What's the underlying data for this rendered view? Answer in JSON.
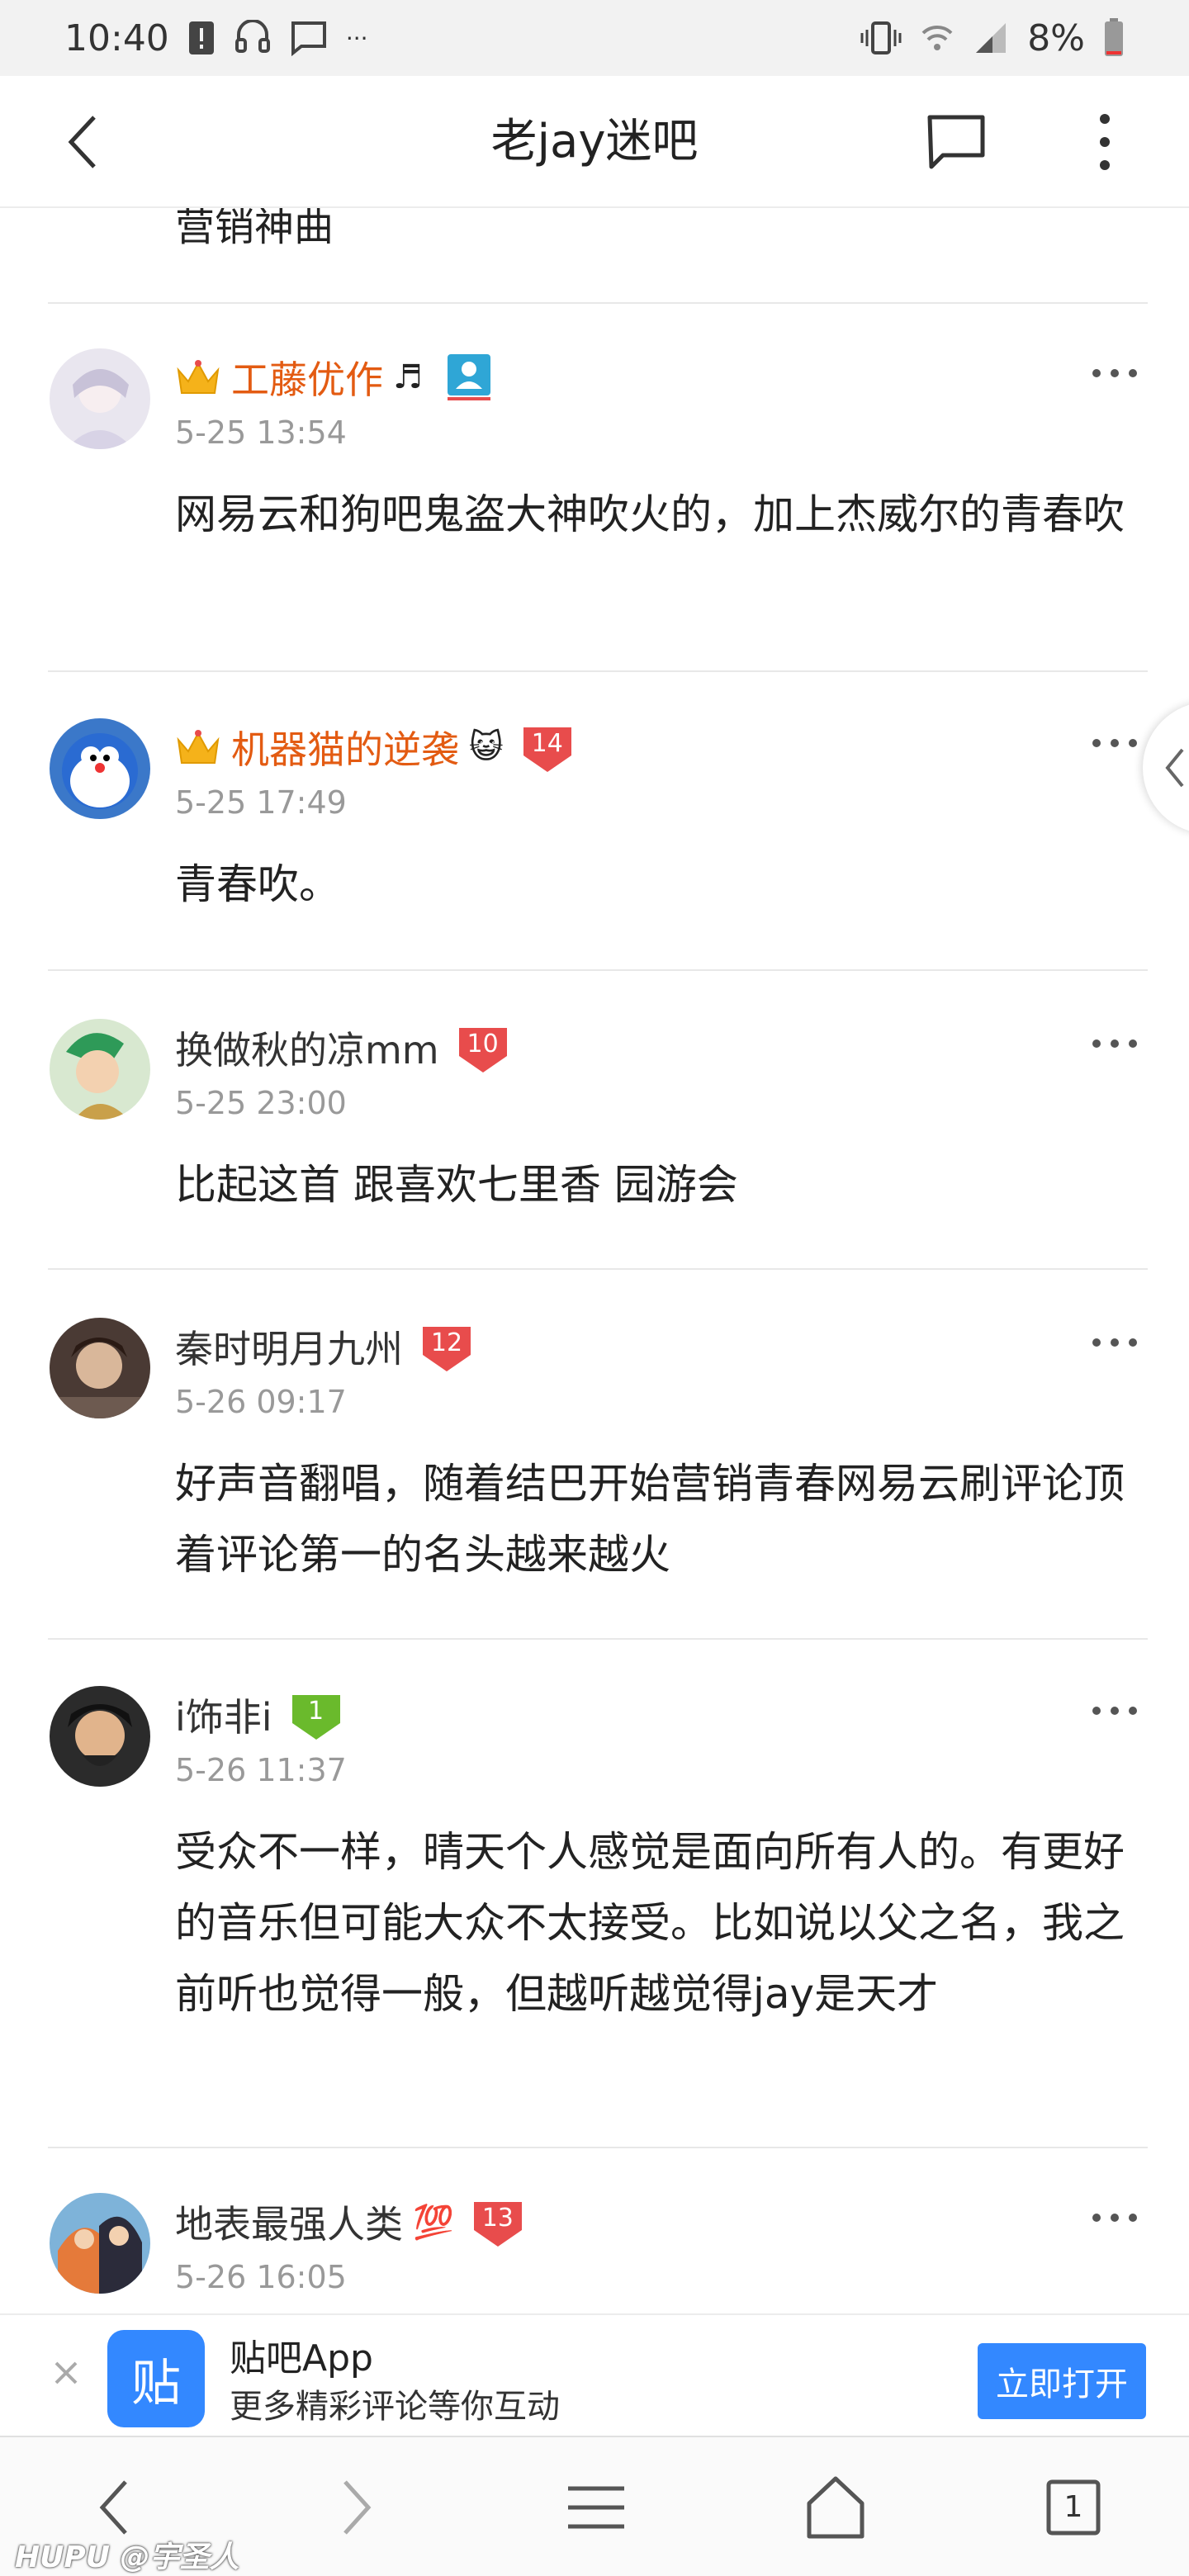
{
  "status_bar": {
    "time": "10:40",
    "notif_more": "···",
    "battery": "8%",
    "icons": [
      "alert-icon",
      "headset-icon",
      "message-icon",
      "vibrate-icon",
      "wifi-icon",
      "signal-icon",
      "battery-icon"
    ]
  },
  "nav": {
    "title": "老jay迷吧",
    "back_icon": "back-arrow-icon",
    "chat_icon": "comment-icon",
    "more_icon": "more-vertical-icon"
  },
  "feed": {
    "cut_text": "营销神曲",
    "posts": [
      {
        "username": "工藤优作",
        "suffix": "♬",
        "vip": true,
        "badge_type": "user-card",
        "time": "5-25 13:54",
        "body": "网易云和狗吧鬼盗大神吹火的，加上杰威尔的青春吹"
      },
      {
        "username": "机器猫的逆袭",
        "suffix": "😺",
        "vip": true,
        "badge_type": "level",
        "level": "14",
        "time": "5-25 17:49",
        "body": "青春吹。"
      },
      {
        "username": "换做秋的凉mm",
        "suffix": "",
        "vip": false,
        "badge_type": "level",
        "level": "10",
        "time": "5-25 23:00",
        "body": "比起这首 跟喜欢七里香 园游会"
      },
      {
        "username": "秦时明月九州",
        "suffix": "",
        "vip": false,
        "badge_type": "level",
        "level": "12",
        "time": "5-26 09:17",
        "body": "好声音翻唱，随着结巴开始营销青春网易云刷评论顶着评论第一的名头越来越火"
      },
      {
        "username": "i饰非i",
        "suffix": "",
        "vip": false,
        "badge_type": "level-green",
        "level": "1",
        "time": "5-26 11:37",
        "body": "受众不一样，晴天个人感觉是面向所有人的。有更好的音乐但可能大众不太接受。比如说以父之名，我之前听也觉得一般，但越听越觉得jay是天才"
      },
      {
        "username": "地表最强人类",
        "suffix": "💯",
        "vip": false,
        "badge_type": "level",
        "level": "13",
        "time": "5-26 16:05",
        "body": ""
      }
    ]
  },
  "banner": {
    "logo_text": "贴",
    "app_name": "贴吧App",
    "desc": "更多精彩评论等你互动",
    "open_label": "立即打开"
  },
  "bottom_nav": {
    "tab_count": "1",
    "items": [
      "back-icon",
      "forward-icon",
      "menu-icon",
      "home-icon",
      "tabs-icon"
    ]
  },
  "watermark": "HUPU @宇圣人",
  "colors": {
    "vip_name": "#e35b12",
    "level_badge": "#e84c4c",
    "level_badge_green": "#6aba2c",
    "accent_blue": "#3388ff"
  }
}
